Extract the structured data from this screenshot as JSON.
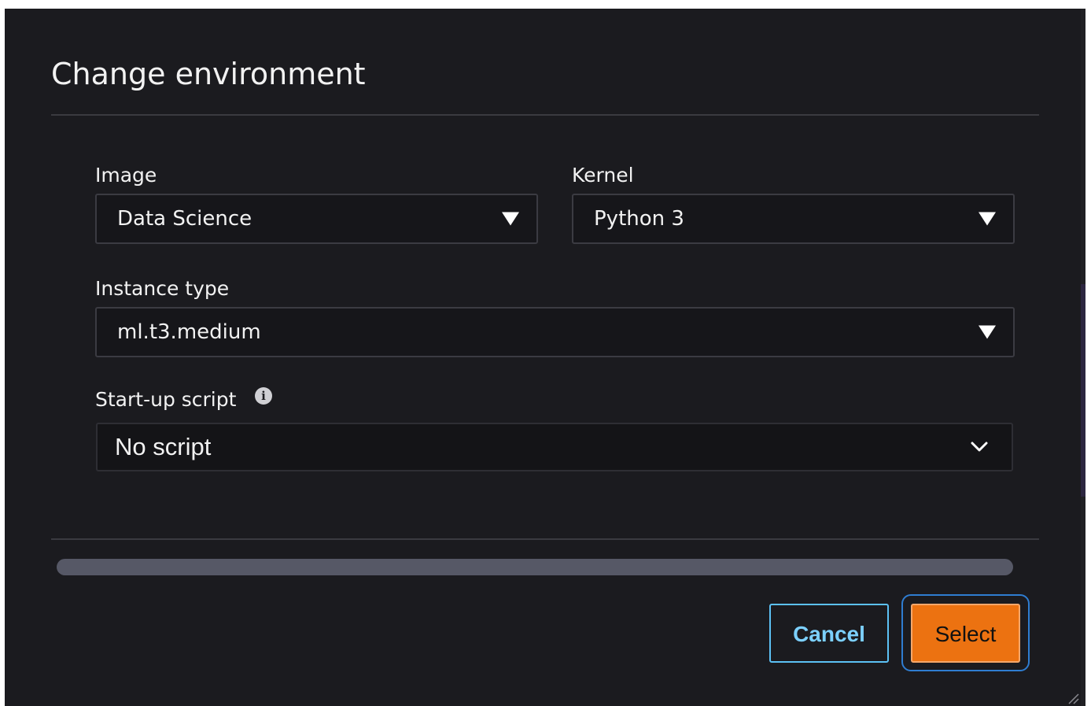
{
  "dialog": {
    "title": "Change environment"
  },
  "fields": {
    "image": {
      "label": "Image",
      "value": "Data Science"
    },
    "kernel": {
      "label": "Kernel",
      "value": "Python 3"
    },
    "instance_type": {
      "label": "Instance type",
      "value": "ml.t3.medium"
    },
    "startup_script": {
      "label": "Start-up script",
      "value": "No script",
      "info_icon": "info-icon"
    }
  },
  "buttons": {
    "cancel": "Cancel",
    "select": "Select"
  },
  "colors": {
    "background": "#1b1b1f",
    "primary_button": "#ec7211",
    "secondary_button_text": "#7cd0ff",
    "focus_ring": "#2f7dd1"
  }
}
